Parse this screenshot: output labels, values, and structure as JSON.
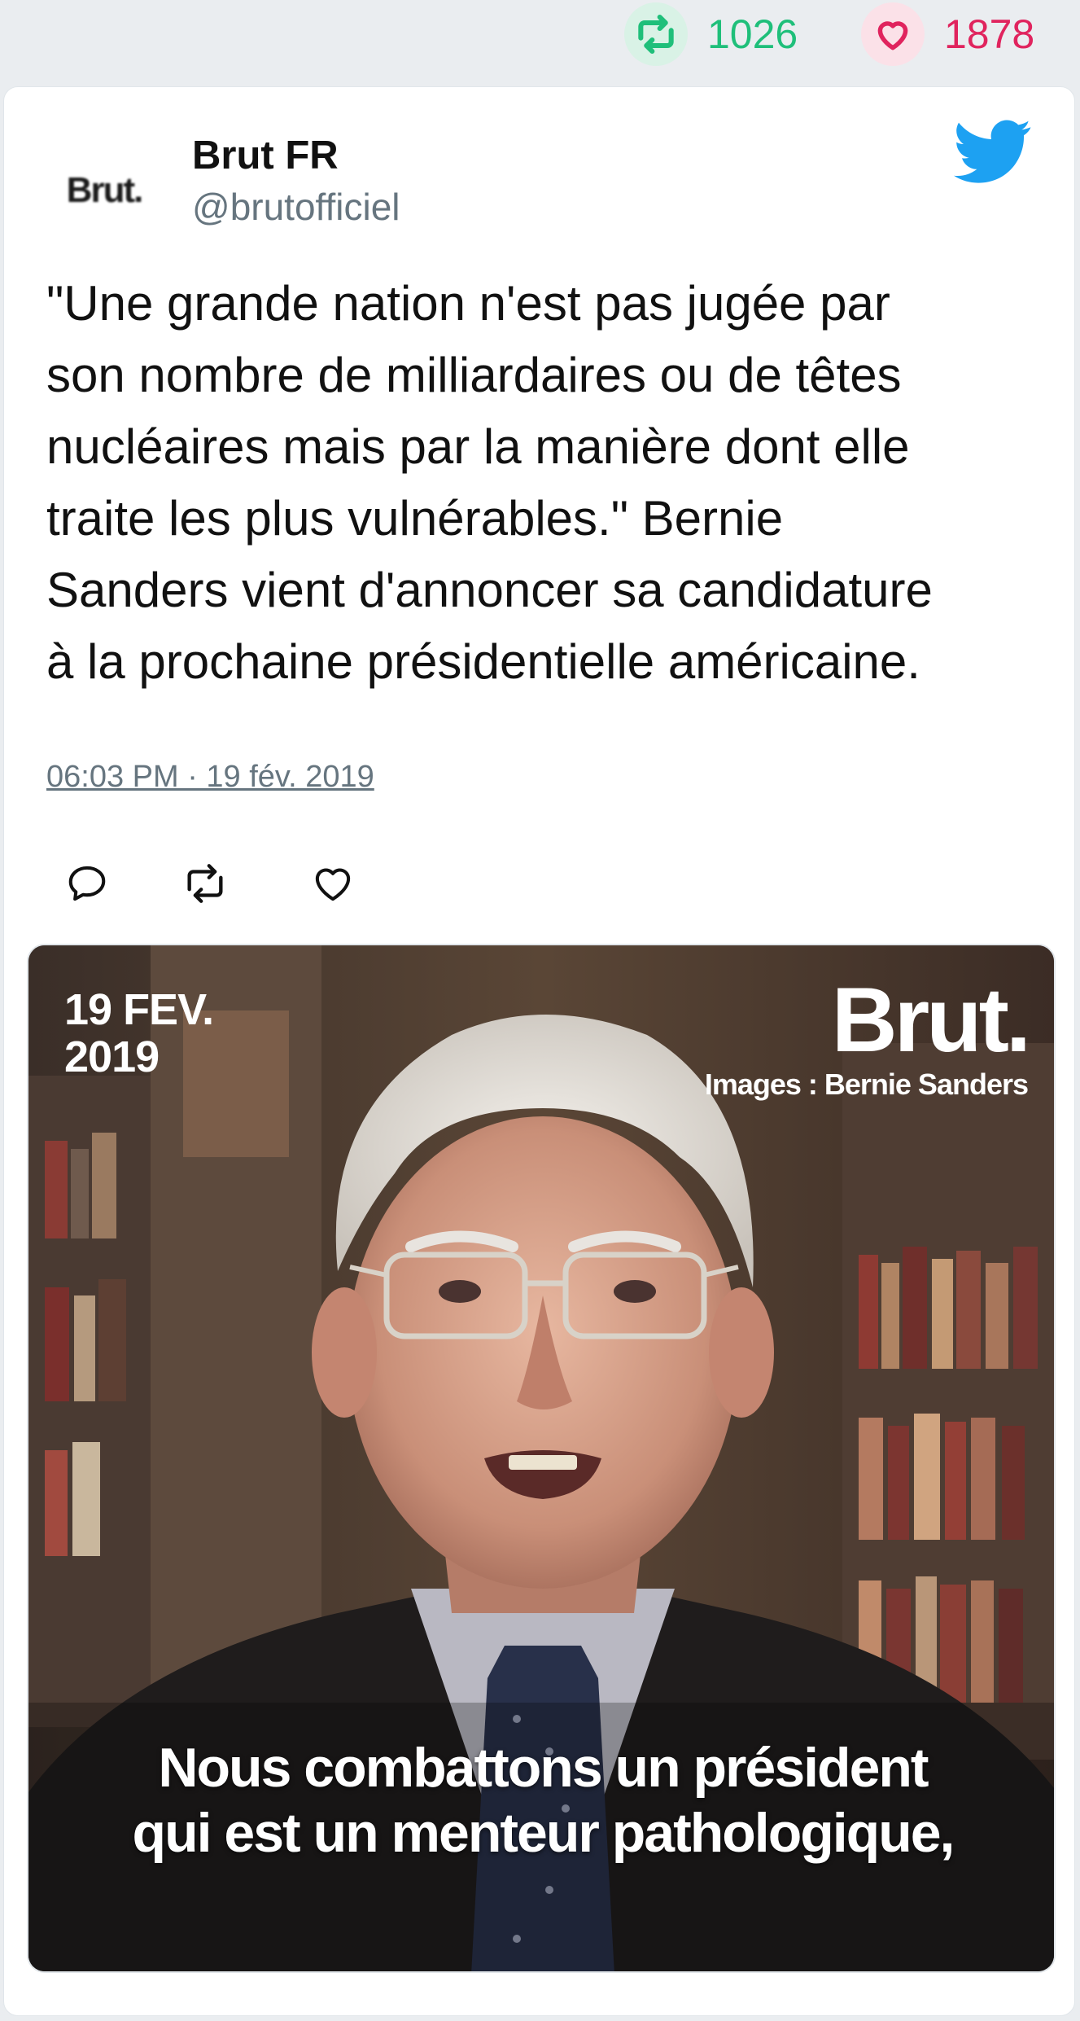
{
  "stats": {
    "retweets": "1026",
    "likes": "1878",
    "retweet_color": "#1fbf7a",
    "like_color": "#e0245e"
  },
  "tweet": {
    "avatar_text": "Brut.",
    "display_name": "Brut FR",
    "handle": "@brutofficiel",
    "text": "\"Une grande nation n'est pas jugée par\nson nombre de milliardaires ou de têtes\nnucléaires mais par la manière dont elle\ntraite les plus vulnérables.\" Bernie\nSanders vient d'annoncer sa candidature\nà la prochaine présidentielle américaine.",
    "timestamp": "06:03 PM · 19 fév. 2019",
    "accent_color": "#1da1f2",
    "actions": [
      "reply-icon",
      "retweet-icon",
      "like-icon"
    ]
  },
  "media": {
    "date_overlay": "19 FEV.\n2019",
    "brand_overlay": "Brut.",
    "credit_overlay": "Images : Bernie Sanders",
    "caption_overlay": "Nous combattons un président\nqui est un menteur pathologique,"
  }
}
